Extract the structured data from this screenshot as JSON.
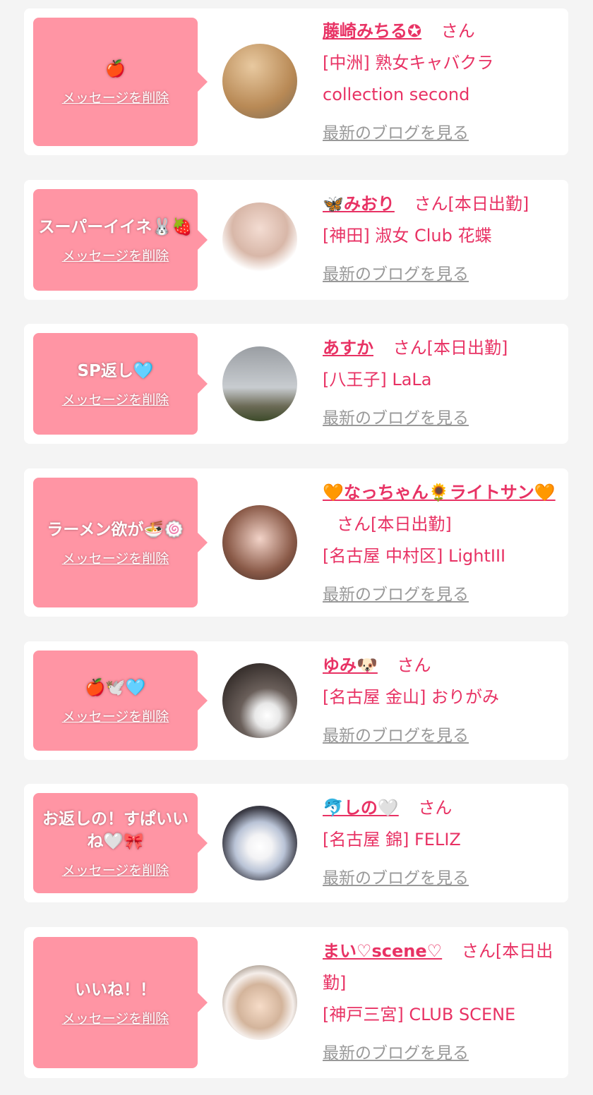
{
  "items": [
    {
      "message": "🍎",
      "delete_label": "メッセージを削除",
      "name": "藤崎みちる✪",
      "honorific": "さん",
      "status": "",
      "shop": "[中洲] 熟女キャバクラ collection second",
      "blog_link": "最新のブログを見る"
    },
    {
      "message": "スーパーイイネ🐰🍓",
      "delete_label": "メッセージを削除",
      "name": "🦋みおり",
      "honorific": "さん",
      "status": "[本日出勤]",
      "shop": "[神田] 淑女 Club 花蝶",
      "blog_link": "最新のブログを見る"
    },
    {
      "message": "SP返し🩵",
      "delete_label": "メッセージを削除",
      "name": "あすか",
      "honorific": "さん",
      "status": "[本日出勤]",
      "shop": "[八王子] LaLa",
      "blog_link": "最新のブログを見る"
    },
    {
      "message": "ラーメン欲が🍜🍥",
      "delete_label": "メッセージを削除",
      "name": "🧡なっちゃん🌻ライトサン🧡",
      "honorific": "さん",
      "status": "[本日出勤]",
      "shop": "[名古屋 中村区] LightIII",
      "blog_link": "最新のブログを見る"
    },
    {
      "message": "🍎🕊️🩵",
      "delete_label": "メッセージを削除",
      "name": "ゆみ🐶",
      "honorific": "さん",
      "status": "",
      "shop": "[名古屋 金山] おりがみ",
      "blog_link": "最新のブログを見る"
    },
    {
      "message": "お返しの！すぱいいね🤍🎀",
      "delete_label": "メッセージを削除",
      "name": "🐬しの🤍",
      "honorific": "さん",
      "status": "",
      "shop": "[名古屋 錦] FELIZ",
      "blog_link": "最新のブログを見る"
    },
    {
      "message": "いいね！！",
      "delete_label": "メッセージを削除",
      "name": "まい♡scene♡",
      "honorific": "さん",
      "status": "[本日出勤]",
      "shop": "[神戸三宮] CLUB SCENE",
      "blog_link": "最新のブログを見る"
    }
  ],
  "colors": {
    "page_bg": "#f4f4f4",
    "bubble": "#ff95a4",
    "accent_text": "#e83264",
    "muted_link": "#999999"
  }
}
